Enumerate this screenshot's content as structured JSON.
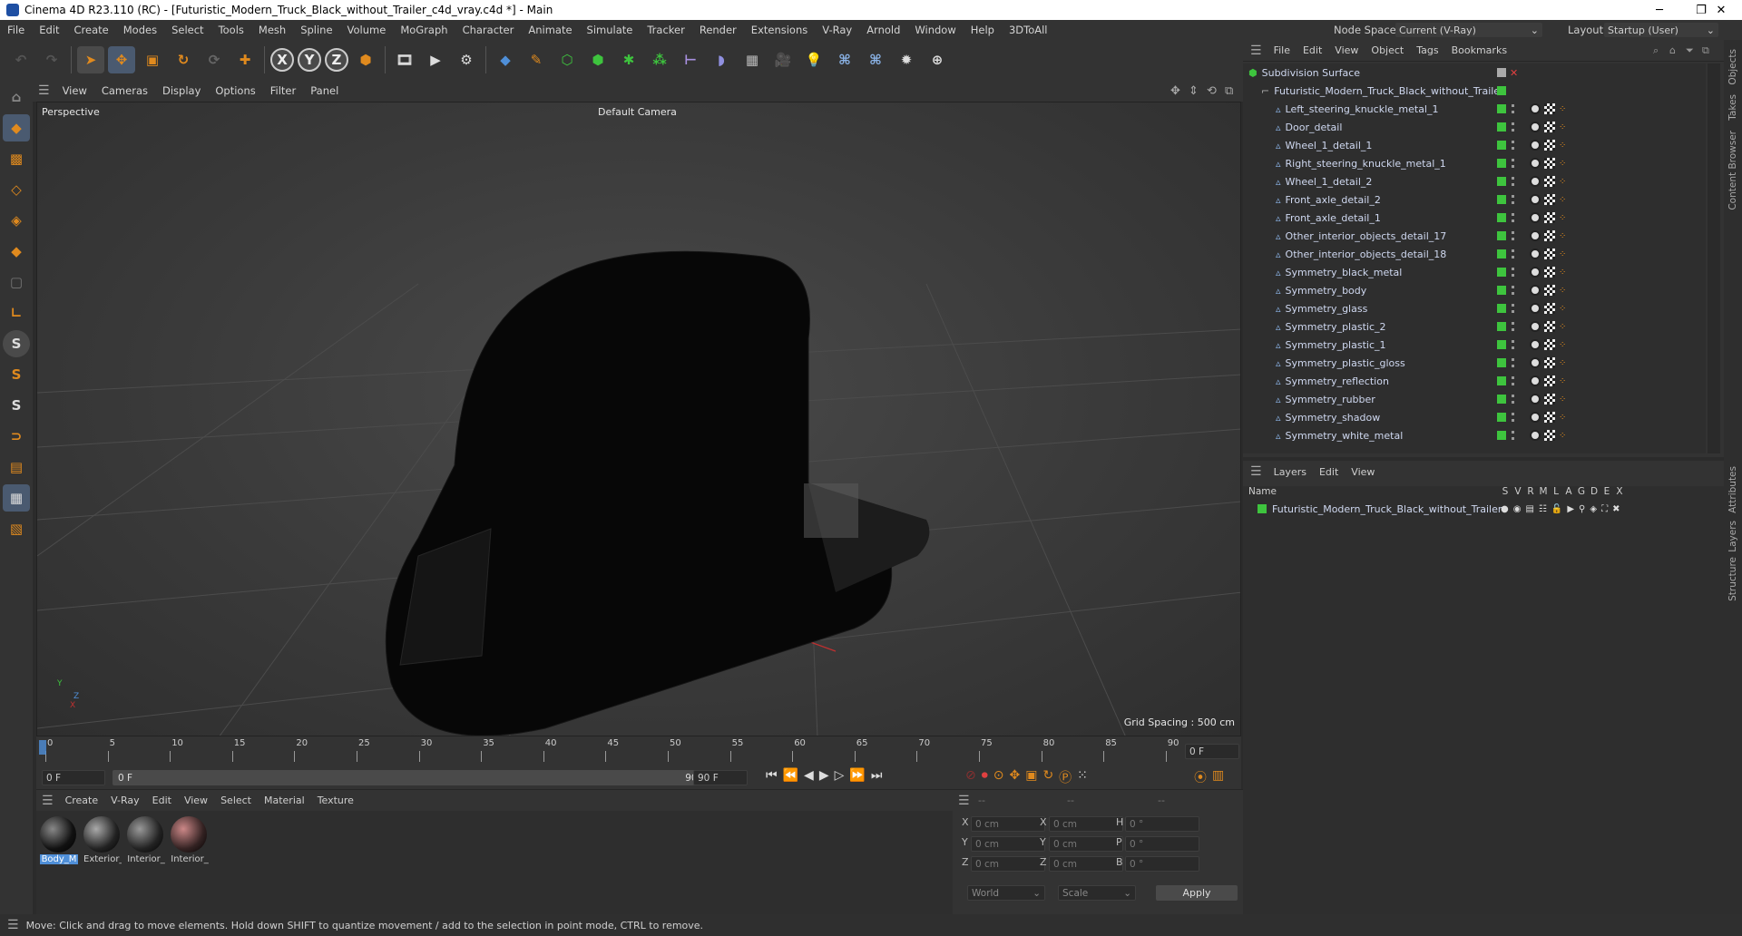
{
  "window": {
    "title": "Cinema 4D R23.110 (RC) - [Futuristic_Modern_Truck_Black_without_Trailer_c4d_vray.c4d *] - Main",
    "minimize": "─",
    "maximize": "❐",
    "close": "✕"
  },
  "menubar": {
    "items": [
      "File",
      "Edit",
      "Create",
      "Modes",
      "Select",
      "Tools",
      "Mesh",
      "Spline",
      "Volume",
      "MoGraph",
      "Character",
      "Animate",
      "Simulate",
      "Tracker",
      "Render",
      "Extensions",
      "V-Ray",
      "Arnold",
      "Window",
      "Help",
      "3DToAll"
    ],
    "node_space_label": "Node Space:",
    "node_space_value": "Current (V-Ray)",
    "layout_label": "Layout:",
    "layout_value": "Startup (User)"
  },
  "toolbar": {
    "x_axis": "X",
    "y_axis": "Y",
    "z_axis": "Z"
  },
  "viewport": {
    "menu": [
      "View",
      "Cameras",
      "Display",
      "Options",
      "Filter",
      "Panel"
    ],
    "mode_label": "Perspective",
    "camera_label": "Default Camera",
    "grid_spacing": "Grid Spacing : 500 cm",
    "axis_y": "Y",
    "axis_z": "Z",
    "axis_x": "X"
  },
  "object_manager": {
    "menu": [
      "File",
      "Edit",
      "View",
      "Object",
      "Tags",
      "Bookmarks"
    ],
    "root": "Subdivision Surface",
    "group": "Futuristic_Modern_Truck_Black_without_Trailer",
    "children": [
      "Left_steering_knuckle_metal_1",
      "Door_detail",
      "Wheel_1_detail_1",
      "Right_steering_knuckle_metal_1",
      "Wheel_1_detail_2",
      "Front_axle_detail_2",
      "Front_axle_detail_1",
      "Other_interior_objects_detail_17",
      "Other_interior_objects_detail_18",
      "Symmetry_black_metal",
      "Symmetry_body",
      "Symmetry_glass",
      "Symmetry_plastic_2",
      "Symmetry_plastic_1",
      "Symmetry_plastic_gloss",
      "Symmetry_reflection",
      "Symmetry_rubber",
      "Symmetry_shadow",
      "Symmetry_white_metal"
    ]
  },
  "right_tabs": {
    "top": [
      "Objects",
      "Takes",
      "Content Browser"
    ],
    "bottom": [
      "Attributes",
      "Layers",
      "Structure"
    ]
  },
  "layers": {
    "menu": [
      "Layers",
      "Edit",
      "View"
    ],
    "name_header": "Name",
    "columns": [
      "S",
      "V",
      "R",
      "M",
      "L",
      "A",
      "G",
      "D",
      "E",
      "X"
    ],
    "rows": [
      "Futuristic_Modern_Truck_Black_without_Trailer"
    ]
  },
  "timeline": {
    "ticks": [
      "0",
      "5",
      "10",
      "15",
      "20",
      "25",
      "30",
      "35",
      "40",
      "45",
      "50",
      "55",
      "60",
      "65",
      "70",
      "75",
      "80",
      "85",
      "90"
    ],
    "current_frame": "0 F"
  },
  "transport": {
    "start_field": "0 F",
    "range_start": "0 F",
    "range_end": "90 F",
    "end_field": "90 F"
  },
  "materials": {
    "menu": [
      "Create",
      "V-Ray",
      "Edit",
      "View",
      "Select",
      "Material",
      "Texture"
    ],
    "items": [
      "Body_M",
      "Exterior_",
      "Interior_",
      "Interior_"
    ]
  },
  "coordinates": {
    "headers": [
      "--",
      "--",
      "--"
    ],
    "rows": [
      {
        "a": "X",
        "av": "0 cm",
        "b": "X",
        "bv": "0 cm",
        "c": "H",
        "cv": "0 °"
      },
      {
        "a": "Y",
        "av": "0 cm",
        "b": "Y",
        "bv": "0 cm",
        "c": "P",
        "cv": "0 °"
      },
      {
        "a": "Z",
        "av": "0 cm",
        "b": "Z",
        "bv": "0 cm",
        "c": "B",
        "cv": "0 °"
      }
    ],
    "space": "World",
    "mode": "Scale",
    "apply": "Apply"
  },
  "status": {
    "text": "Move: Click and drag to move elements. Hold down SHIFT to quantize movement / add to the selection in point mode, CTRL to remove."
  },
  "colors": {
    "accent_orange": "#e08a1e",
    "accent_blue": "#4f8fd8",
    "green_check": "#3ec43e",
    "object_text": "#cfd8f0"
  }
}
